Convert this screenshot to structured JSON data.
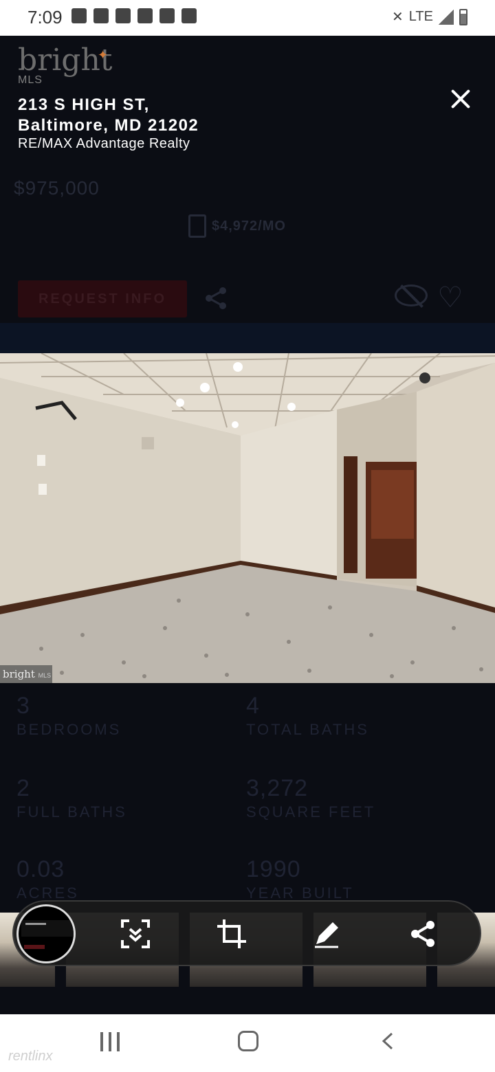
{
  "status_bar": {
    "time": "7:09",
    "network": "LTE"
  },
  "brand": {
    "name": "bright",
    "sub": "MLS"
  },
  "listing": {
    "address_line1": "213 S HIGH ST,",
    "address_line2": "Baltimore, MD 21202",
    "broker": "RE/MAX Advantage Realty",
    "price": "$975,000",
    "monthly": "$4,972/MO"
  },
  "actions": {
    "request_info": "REQUEST INFO"
  },
  "photo": {
    "watermark_brand": "bright",
    "watermark_sub": "MLS"
  },
  "stats": [
    {
      "value": "3",
      "label": "BEDROOMS"
    },
    {
      "value": "4",
      "label": "TOTAL BATHS"
    },
    {
      "value": "2",
      "label": "FULL BATHS"
    },
    {
      "value": "3,272",
      "label": "SQUARE FEET"
    },
    {
      "value": "0.03",
      "label": "ACRES"
    },
    {
      "value": "1990",
      "label": "YEAR BUILT"
    }
  ],
  "capture_toolbar": {
    "tools": [
      "scroll-capture-icon",
      "crop-icon",
      "draw-icon",
      "share-icon"
    ]
  },
  "nav_bar": {
    "watermark": "rentlinx"
  }
}
